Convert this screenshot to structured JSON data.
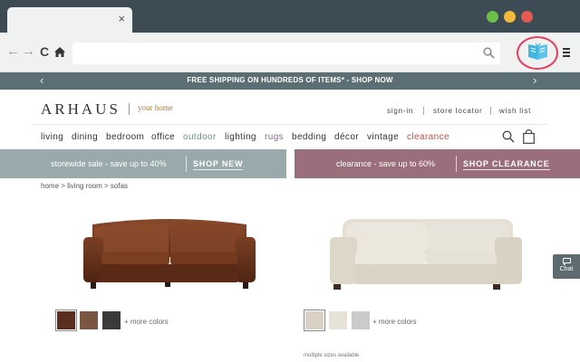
{
  "browser": {
    "tab_close": "×",
    "nav": {
      "back": "←",
      "forward": "→",
      "reload": "C"
    },
    "colors": {
      "titlebar": "#3d4b54",
      "extension_ring": "#e53e63",
      "extension_icon": "#3fb6e0"
    }
  },
  "promo": {
    "text": "FREE SHIPPING ON HUNDREDS OF ITEMS* - SHOP NOW",
    "prev": "‹",
    "next": "›"
  },
  "header": {
    "logo": "ARHAUS",
    "tagline": "your home",
    "links": {
      "sign_in": "sign-in",
      "store_locator": "store locator",
      "wish_list": "wish list"
    }
  },
  "categories": {
    "living": "living",
    "dining": "dining",
    "bedroom": "bedroom",
    "office": "office",
    "outdoor": "outdoor",
    "lighting": "lighting",
    "rugs": "rugs",
    "bedding": "bedding",
    "decor": "décor",
    "vintage": "vintage",
    "clearance": "clearance"
  },
  "banners": {
    "left": {
      "text": "storewide sale - save up to 40%",
      "link": "SHOP NEW",
      "color": "#98aaab"
    },
    "right": {
      "text": "clearance - save up to 60%",
      "link": "SHOP CLEARANCE",
      "color": "#9a6e7b"
    }
  },
  "breadcrumb": "home > living room > sofas",
  "products": [
    {
      "image": "leather-sofa",
      "swatches": [
        "#5a2d1e",
        "#7a5544",
        "#3a3a3a"
      ],
      "more_colors": "+ more colors"
    },
    {
      "image": "fabric-sofa",
      "swatches": [
        "#d9d2c4",
        "#e6e2d6",
        "#c9ccc8"
      ],
      "more_colors": "+ more colors",
      "note": "multiple sizes available"
    }
  ],
  "chat": {
    "label": "Chat"
  }
}
